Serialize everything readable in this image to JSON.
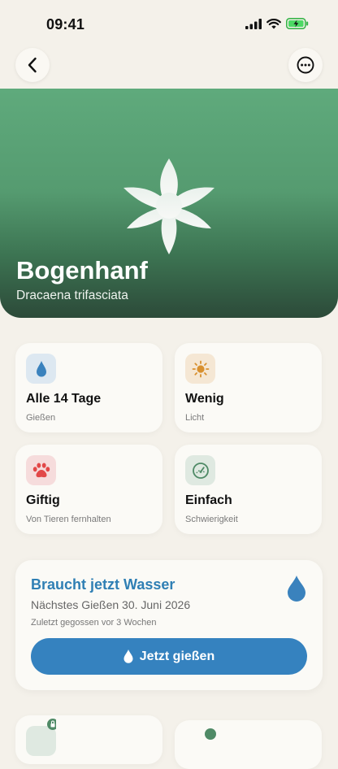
{
  "status_bar": {
    "time": "09:41"
  },
  "nav": {
    "back_icon": "chevron-left-icon",
    "more_icon": "ellipsis-circle-icon"
  },
  "plant": {
    "name": "Bogenhanf",
    "scientific_name": "Dracaena trifasciata"
  },
  "care": [
    {
      "title": "Alle 14 Tage",
      "subtitle": "Gießen",
      "icon": "water-drop-icon",
      "color": "#3a82bd",
      "bg": "#dde8f1"
    },
    {
      "title": "Wenig",
      "subtitle": "Licht",
      "icon": "sun-icon",
      "color": "#d8902f",
      "bg": "#f5e7d4"
    },
    {
      "title": "Giftig",
      "subtitle": "Von Tieren fernhalten",
      "icon": "paw-icon",
      "color": "#e24848",
      "bg": "#f6dcdc"
    },
    {
      "title": "Einfach",
      "subtitle": "Schwierigkeit",
      "icon": "gauge-icon",
      "color": "#4f8a66",
      "bg": "#dfe9e1"
    }
  ],
  "watering": {
    "title": "Braucht jetzt Wasser",
    "next": "Nächstes Gießen 30. Juni 2026",
    "last": "Zuletzt gegossen vor 3 Wochen",
    "button_label": "Jetzt gießen",
    "accent": "#3582bf"
  }
}
